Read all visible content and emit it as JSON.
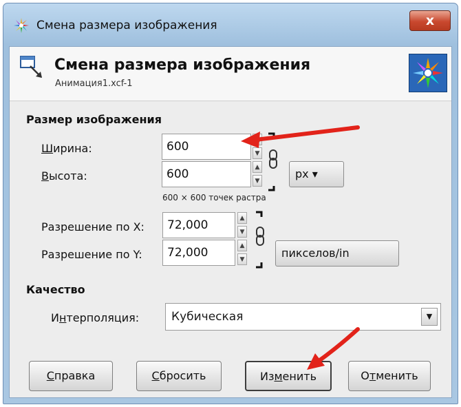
{
  "window": {
    "title": "Смена размера изображения",
    "close_label": "x"
  },
  "header": {
    "title": "Смена размера изображения",
    "subtitle": "Анимация1.xcf-1"
  },
  "image_size": {
    "section_label": "Размер изображения",
    "width_label_accel": "Ш",
    "width_label_rest": "ирина:",
    "width_value": "600",
    "height_label_accel": "В",
    "height_label_rest": "ысота:",
    "height_value": "600",
    "unit": "px",
    "pixel_note": "600 × 600 точек растра",
    "res_x_label": "Разрешение по X:",
    "res_x_value": "72,000",
    "res_y_label": "Разрешение по Y:",
    "res_y_value": "72,000",
    "res_unit": "пикселов/in"
  },
  "quality": {
    "section_label": "Качество",
    "interp_label_pre": "И",
    "interp_label_accel": "н",
    "interp_label_rest": "терполяция:",
    "interp_value": "Кубическая"
  },
  "buttons": {
    "help_accel": "С",
    "help_rest": "правка",
    "reset_accel": "С",
    "reset_rest": "бросить",
    "apply_pre": "Из",
    "apply_accel": "м",
    "apply_rest": "енить",
    "cancel_pre": "О",
    "cancel_accel": "т",
    "cancel_rest": "менить"
  },
  "colors": {
    "annotation_arrow": "#e2231a",
    "title_bar": "#bed8ef",
    "dialog_bg": "#ededed"
  }
}
